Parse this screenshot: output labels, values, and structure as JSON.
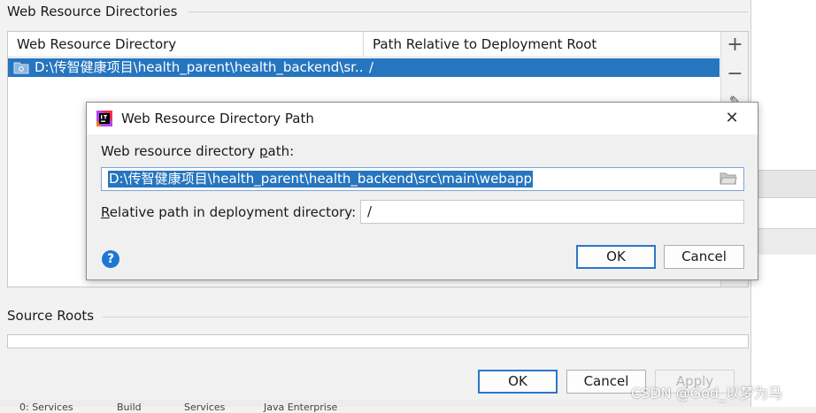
{
  "background": {
    "web_resource_section_title": "Web Resource Directories",
    "table": {
      "columns": [
        "Web Resource Directory",
        "Path Relative to Deployment Root"
      ],
      "rows": [
        {
          "directory": "D:\\传智健康项目\\health_parent\\health_backend\\sr...",
          "relative_path": "/"
        }
      ]
    },
    "toolbar": {
      "add_label": "+",
      "remove_label": "−",
      "edit_label": "✎"
    },
    "source_roots_title": "Source Roots",
    "buttons": {
      "ok": "OK",
      "cancel": "Cancel",
      "apply": "Apply"
    },
    "bottom_tabs": [
      "0: Services",
      "Build",
      "Services",
      "Java Enterprise"
    ]
  },
  "dialog": {
    "title": "Web Resource Directory Path",
    "path_label_prefix": "Web resource directory ",
    "path_label_mnemonic": "p",
    "path_label_suffix": "ath:",
    "path_value": "D:\\传智健康项目\\health_parent\\health_backend\\src\\main\\webapp",
    "relative_label_mnemonic": "R",
    "relative_label_suffix": "elative path in deployment directory:",
    "relative_value": "/",
    "help_label": "?",
    "ok_label": "OK",
    "cancel_label": "Cancel",
    "close_label": "✕"
  },
  "watermark": "CSDN @God_以梦为马",
  "colors": {
    "selection": "#2675bf",
    "default_button_border": "#2c76c8",
    "help_icon": "#1e78d2",
    "app_icon": [
      "#f97a12",
      "#b345f1",
      "#fe2857",
      "#000000"
    ]
  },
  "icons": [
    "folder-icon",
    "add-icon",
    "remove-icon",
    "edit-icon",
    "intellij-app-icon",
    "close-icon",
    "browse-folder-icon",
    "help-icon"
  ]
}
